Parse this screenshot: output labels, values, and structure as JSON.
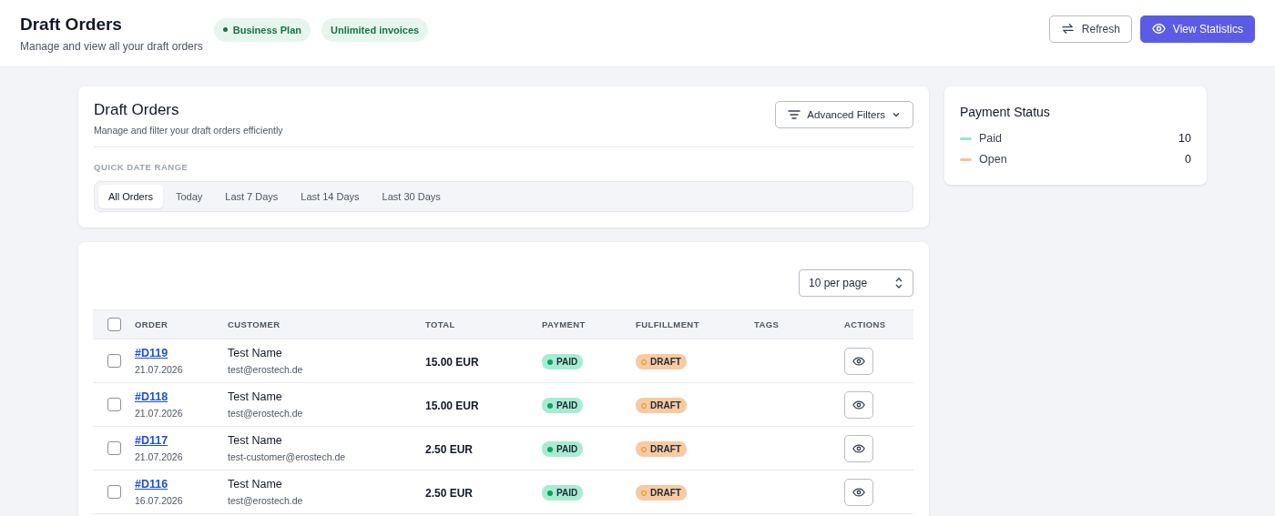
{
  "header": {
    "title": "Draft Orders",
    "subtitle": "Manage and view all your draft orders",
    "badges": [
      {
        "label": "Business Plan",
        "dot": true
      },
      {
        "label": "Unlimited invoices",
        "dot": false
      }
    ],
    "buttons": [
      {
        "label": "Refresh",
        "kind": "secondary"
      },
      {
        "label": "View Statistics",
        "kind": "primary"
      }
    ]
  },
  "filters": {
    "title": "Draft Orders",
    "subtitle": "Manage and filter your draft orders efficiently",
    "advanced_button": "Advanced Filters",
    "range_label": "QUICK DATE RANGE",
    "ranges": [
      {
        "label": "All Orders",
        "selected": true
      },
      {
        "label": "Today",
        "selected": false
      },
      {
        "label": "Last 7 Days",
        "selected": false
      },
      {
        "label": "Last 14 Days",
        "selected": false
      },
      {
        "label": "Last 30 Days",
        "selected": false
      }
    ]
  },
  "payment_status": {
    "title": "Payment Status",
    "items": [
      {
        "label": "Paid",
        "count": "10",
        "color": "#99e6c8"
      },
      {
        "label": "Open",
        "count": "0",
        "color": "#f7c29c"
      }
    ]
  },
  "table": {
    "per_page": "10 per page",
    "select_all_checked": false,
    "columns": [
      "ORDER",
      "CUSTOMER",
      "TOTAL",
      "PAYMENT",
      "FULFILLMENT",
      "TAGS",
      "ACTIONS"
    ],
    "rows": [
      {
        "checked": false,
        "order": "#D119",
        "date": "21.07.2026",
        "name": "Test Name",
        "email": "test@erostech.de",
        "total": "15.00 EUR",
        "payment": {
          "label": "PAID",
          "kind": "paid"
        },
        "fulfillment": {
          "label": "DRAFT",
          "kind": "draft"
        }
      },
      {
        "checked": false,
        "order": "#D118",
        "date": "21.07.2026",
        "name": "Test Name",
        "email": "test@erostech.de",
        "total": "15.00 EUR",
        "payment": {
          "label": "PAID",
          "kind": "paid"
        },
        "fulfillment": {
          "label": "DRAFT",
          "kind": "draft"
        }
      },
      {
        "checked": false,
        "order": "#D117",
        "date": "21.07.2026",
        "name": "Test Name",
        "email": "test-customer@erostech.de",
        "total": "2.50 EUR",
        "payment": {
          "label": "PAID",
          "kind": "paid"
        },
        "fulfillment": {
          "label": "DRAFT",
          "kind": "draft"
        }
      },
      {
        "checked": false,
        "order": "#D116",
        "date": "16.07.2026",
        "name": "Test Name",
        "email": "test@erostech.de",
        "total": "2.50 EUR",
        "payment": {
          "label": "PAID",
          "kind": "paid"
        },
        "fulfillment": {
          "label": "DRAFT",
          "kind": "draft"
        }
      }
    ]
  }
}
